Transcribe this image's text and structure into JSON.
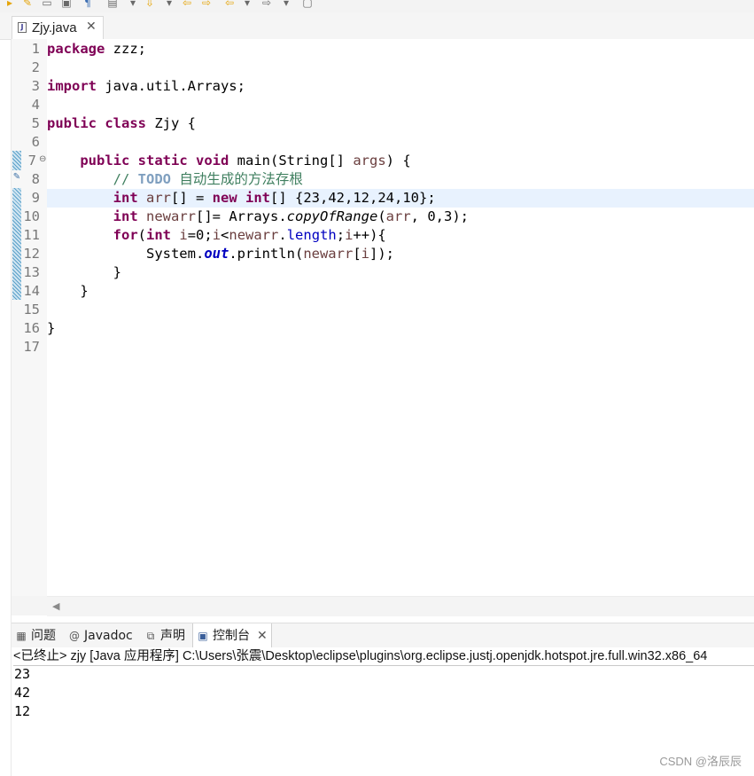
{
  "editor": {
    "tab_label": "Zjy.java",
    "tab_close": "✕",
    "line_numbers": [
      "1",
      "2",
      "3",
      "4",
      "5",
      "6",
      "7",
      "8",
      "9",
      "10",
      "11",
      "12",
      "13",
      "14",
      "15",
      "16",
      "17"
    ],
    "code": {
      "l1_kw": "package",
      "l1_rest": " zzz;",
      "l3_kw": "import",
      "l3_rest": " java.util.Arrays;",
      "l5_kw1": "public",
      "l5_kw2": "class",
      "l5_rest": " Zjy {",
      "l7_kw1": "public",
      "l7_kw2": "static",
      "l7_kw3": "void",
      "l7_mid": " main(String[] ",
      "l7_var": "args",
      "l7_end": ") {",
      "l8_comment": "// ",
      "l8_todo": "TODO",
      "l8_text": " 自动生成的方法存根",
      "l9_kw1": "int",
      "l9_var": "arr",
      "l9_mid": "[] = ",
      "l9_kw2": "new",
      "l9_kw3": "int",
      "l9_end": "[] {23,42,12,24,10};",
      "l10_kw": "int",
      "l10_var": "newarr",
      "l10_mid": "[]= Arrays.",
      "l10_method": "copyOfRange",
      "l10_open": "(",
      "l10_arg": "arr",
      "l10_end": ", 0,3);",
      "l11_kw1": "for",
      "l11_open": "(",
      "l11_kw2": "int",
      "l11_var1": "i",
      "l11_a": "=0;",
      "l11_var2": "i",
      "l11_b": "<",
      "l11_var3": "newarr",
      "l11_c": ".",
      "l11_field": "length",
      "l11_d": ";",
      "l11_var4": "i",
      "l11_e": "++){",
      "l12_a": "System.",
      "l12_field": "out",
      "l12_b": ".println(",
      "l12_var1": "newarr",
      "l12_c": "[",
      "l12_var2": "i",
      "l12_d": "]);",
      "l13": "}",
      "l14": "}",
      "l16": "}"
    }
  },
  "panel": {
    "tabs": [
      {
        "label": "问题",
        "icon": "problems-icon"
      },
      {
        "label": "Javadoc",
        "icon": "javadoc-icon"
      },
      {
        "label": "声明",
        "icon": "declaration-icon"
      },
      {
        "label": "控制台",
        "icon": "console-icon"
      }
    ],
    "active_close": "✕",
    "console_header": "<已终止> zjy [Java 应用程序] C:\\Users\\张震\\Desktop\\eclipse\\plugins\\org.eclipse.justj.openjdk.hotspot.jre.full.win32.x86_64",
    "output": [
      "23",
      "42",
      "12"
    ]
  },
  "watermark": "CSDN @洛辰辰"
}
